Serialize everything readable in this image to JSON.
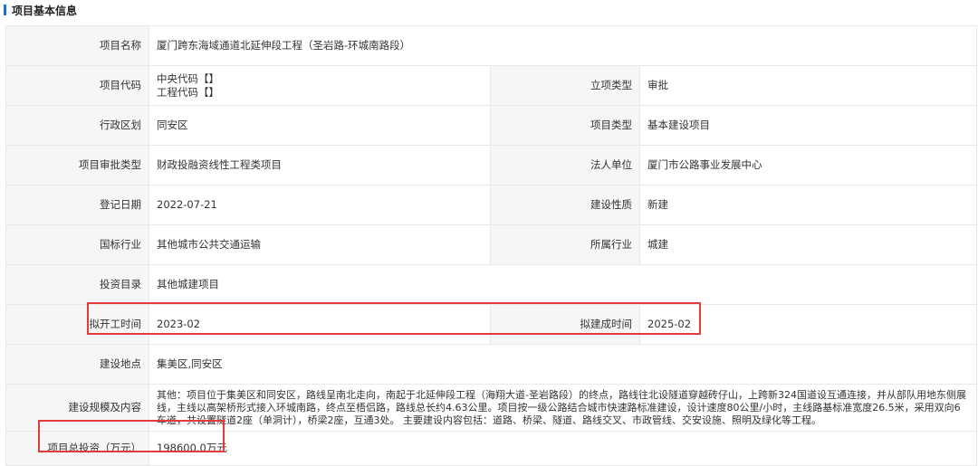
{
  "section": {
    "title": "项目基本信息"
  },
  "rows": {
    "project_name": {
      "label": "项目名称",
      "value": "厦门跨东海域通道北延伸段工程（圣岩路-环城南路段）"
    },
    "project_code": {
      "label": "项目代码",
      "central": "中央代码【】",
      "engineering": "工程代码【】"
    },
    "approval_type": {
      "label": "立项类型",
      "value": "审批"
    },
    "admin_region": {
      "label": "行政区划",
      "value": "同安区"
    },
    "project_type": {
      "label": "项目类型",
      "value": "基本建设项目"
    },
    "review_type": {
      "label": "项目审批类型",
      "value": "财政投融资线性工程类项目"
    },
    "legal_entity": {
      "label": "法人单位",
      "value": "厦门市公路事业发展中心"
    },
    "reg_date": {
      "label": "登记日期",
      "value": "2022-07-21"
    },
    "build_nature": {
      "label": "建设性质",
      "value": "新建"
    },
    "national_industry": {
      "label": "国标行业",
      "value": "其他城市公共交通运输"
    },
    "industry": {
      "label": "所属行业",
      "value": "城建"
    },
    "investment_catalog": {
      "label": "投资目录",
      "value": "其他城建项目"
    },
    "planned_start": {
      "label": "拟开工时间",
      "value": "2023-02"
    },
    "planned_finish": {
      "label": "拟建成时间",
      "value": "2025-02"
    },
    "location": {
      "label": "建设地点",
      "value": "集美区,同安区"
    },
    "scale": {
      "label": "建设规模及内容",
      "value": "其他：项目位于集美区和同安区，路线呈南北走向，南起于北延伸段工程（海翔大道-圣岩路段）的终点，路线往北设隧道穿越砖仔山，上跨新324国道设互通连接，并从部队用地东侧展线，主线以高架桥形式接入环城南路，终点至梧侣路，路线总长约4.63公里。项目按一级公路结合城市快速路标准建设，设计速度80公里/小时，主线路基标准宽度26.5米，采用双向6车道，共设置隧道2座（单洞计），桥梁2座，互通3处。 主要建设内容包括：道路、桥梁、隧道、路线交叉、市政管线、交安设施、照明及绿化等工程。"
    },
    "total_investment": {
      "label": "项目总投资（万元）",
      "value": "198600.0万元"
    }
  },
  "colors": {
    "accent": "#1e6fd9",
    "highlight": "#e23b3b",
    "label_bg": "#f6f6f6",
    "border": "#e9e9e9"
  }
}
